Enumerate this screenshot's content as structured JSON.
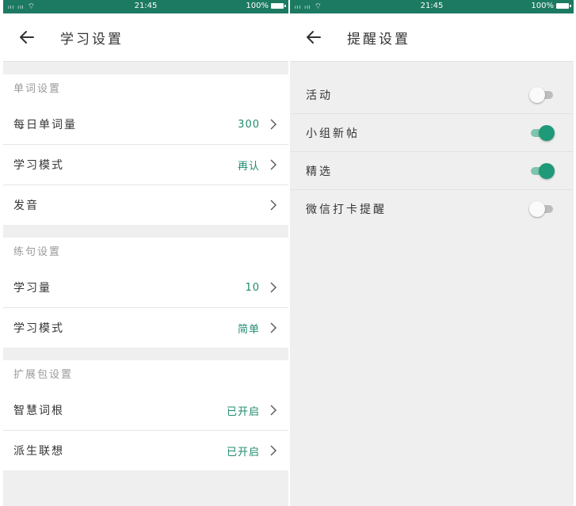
{
  "left": {
    "status": {
      "signal": "ᵢₗₗ ᵢₗₗ ⌔",
      "time": "21:45",
      "battery": "100%"
    },
    "header": {
      "title": "学习设置"
    },
    "sections": [
      {
        "title": "单词设置",
        "rows": [
          {
            "label": "每日单词量",
            "value": "300"
          },
          {
            "label": "学习模式",
            "value": "再认"
          },
          {
            "label": "发音",
            "value": ""
          }
        ]
      },
      {
        "title": "练句设置",
        "rows": [
          {
            "label": "学习量",
            "value": "10"
          },
          {
            "label": "学习模式",
            "value": "简单"
          }
        ]
      },
      {
        "title": "扩展包设置",
        "rows": [
          {
            "label": "智慧词根",
            "value": "已开启"
          },
          {
            "label": "派生联想",
            "value": "已开启"
          }
        ]
      }
    ]
  },
  "right": {
    "status": {
      "signal": "ᵢₗₗ ᵢₗₗ ⌔",
      "time": "21:45",
      "battery": "100%"
    },
    "header": {
      "title": "提醒设置"
    },
    "toggles": [
      {
        "label": "活动",
        "on": false
      },
      {
        "label": "小组新帖",
        "on": true
      },
      {
        "label": "精选",
        "on": true
      },
      {
        "label": "微信打卡提醒",
        "on": false
      }
    ]
  },
  "colors": {
    "statusbar": "#1d7a62",
    "accent": "#1f9a78",
    "value_text": "#1f8a6e"
  }
}
